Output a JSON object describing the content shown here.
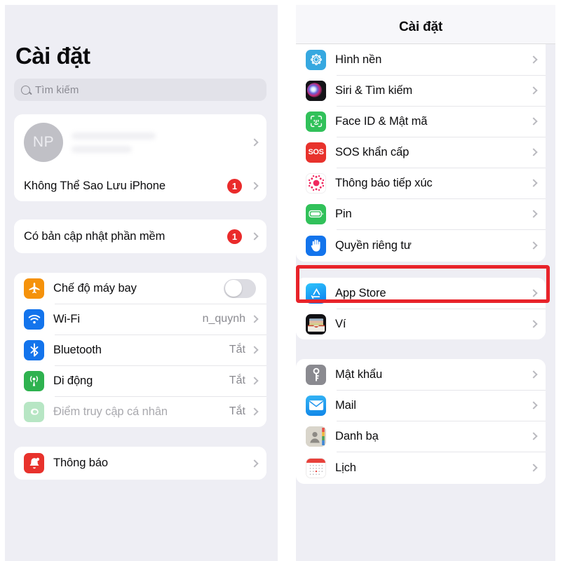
{
  "left_panel": {
    "title": "Cài đặt",
    "search": {
      "placeholder": "Tìm kiếm",
      "icon": "search-icon"
    },
    "account_card": {
      "avatar_initials": "NP",
      "name_redacted": true,
      "rows": [
        {
          "label": "Không Thể Sao Lưu iPhone",
          "badge": "1",
          "chevron": true
        }
      ]
    },
    "update_card": {
      "rows": [
        {
          "label": "Có bản cập nhật phần mềm",
          "badge": "1",
          "chevron": true
        }
      ]
    },
    "connectivity_card": {
      "rows": [
        {
          "label": "Chế độ máy bay",
          "icon": "airplane-icon",
          "icon_color": "#f5920b",
          "control": "toggle",
          "toggle_on": false
        },
        {
          "label": "Wi-Fi",
          "icon": "wifi-icon",
          "icon_color": "#1374ec",
          "value": "n_quynh",
          "chevron": true
        },
        {
          "label": "Bluetooth",
          "icon": "bluetooth-icon",
          "icon_color": "#1374ec",
          "value": "Tắt",
          "chevron": true
        },
        {
          "label": "Di động",
          "icon": "cellular-icon",
          "icon_color": "#2eb24f",
          "value": "Tắt",
          "chevron": true
        },
        {
          "label": "Điểm truy cập cá nhân",
          "icon": "hotspot-icon",
          "icon_color": "#8bd79b",
          "value": "Tắt",
          "chevron": true,
          "dimmed": true
        }
      ]
    },
    "notifications_card": {
      "rows": [
        {
          "label": "Thông báo",
          "icon": "bell-icon",
          "icon_color": "#e8322c",
          "chevron": true
        }
      ]
    }
  },
  "right_panel": {
    "header_title": "Cài đặt",
    "group_system": {
      "rows": [
        {
          "label": "Hình nền",
          "icon": "wallpaper-icon",
          "icon_color": "#36a8e0",
          "chevron": true
        },
        {
          "label": "Siri & Tìm kiếm",
          "icon": "siri-icon",
          "icon_color": "#1a1a1e",
          "chevron": true
        },
        {
          "label": "Face ID & Mật mã",
          "icon": "faceid-icon",
          "icon_color": "#31c15a",
          "chevron": true
        },
        {
          "label": "SOS khẩn cấp",
          "icon": "sos-icon",
          "icon_color": "#e8322c",
          "chevron": true
        },
        {
          "label": "Thông báo tiếp xúc",
          "icon": "exposure-notification-icon",
          "icon_color": "#ffffff",
          "chevron": true
        },
        {
          "label": "Pin",
          "icon": "battery-icon",
          "icon_color": "#31c15a",
          "chevron": true
        },
        {
          "label": "Quyền riêng tư",
          "icon": "privacy-hand-icon",
          "icon_color": "#1374ec",
          "chevron": true,
          "highlighted": true
        }
      ]
    },
    "group_store": {
      "rows": [
        {
          "label": "App Store",
          "icon": "app-store-icon",
          "icon_color": "#0e9bf0",
          "chevron": true
        },
        {
          "label": "Ví",
          "icon": "wallet-icon",
          "icon_color": "#111114",
          "chevron": true
        }
      ]
    },
    "group_apps": {
      "rows": [
        {
          "label": "Mật khẩu",
          "icon": "key-icon",
          "icon_color": "#8a8a90",
          "chevron": true
        },
        {
          "label": "Mail",
          "icon": "mail-icon",
          "icon_color": "#1ea0ef",
          "chevron": true
        },
        {
          "label": "Danh bạ",
          "icon": "contacts-icon",
          "icon_color": "#d6d2c8",
          "chevron": true
        },
        {
          "label": "Lịch",
          "icon": "calendar-icon",
          "icon_color": "#ffffff",
          "chevron": true
        }
      ]
    }
  },
  "annotation": {
    "highlight_color": "#e8232a",
    "highlight_target": "Quyền riêng tư"
  }
}
